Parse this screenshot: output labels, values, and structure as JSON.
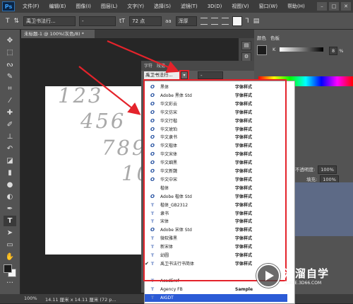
{
  "app": {
    "logo": "Ps"
  },
  "menubar": [
    "文件(F)",
    "编辑(E)",
    "图像(I)",
    "图层(L)",
    "文字(Y)",
    "选择(S)",
    "滤镜(T)",
    "3D(D)",
    "视图(V)",
    "窗口(W)",
    "帮助(H)"
  ],
  "window_controls": [
    "–",
    "□",
    "✕"
  ],
  "options_bar": {
    "tool_icon": "T",
    "font_family": "禹卫书法行...",
    "font_style": "-",
    "font_size": "72 点",
    "antialias": "浑厚"
  },
  "document_tab": "未标题-1 @ 100%(灰色/8) *",
  "canvas_text": [
    "123",
    "456",
    "789",
    "10"
  ],
  "character_panel": {
    "tabs": [
      "字符",
      "段落"
    ],
    "font_field": "禹卫书法行...",
    "dropdown_glyph": "▾",
    "font_style_field": "-"
  },
  "font_list": [
    {
      "icon": "O",
      "name": "黑体",
      "sample": "字体样式"
    },
    {
      "icon": "O",
      "name": "Adobe 黑体 Std",
      "sample": "字体样式"
    },
    {
      "icon": "O",
      "name": "华文彩云",
      "sample": "字体样式"
    },
    {
      "icon": "O",
      "name": "华文仿宋",
      "sample": "字体样式"
    },
    {
      "icon": "O",
      "name": "华文行楷",
      "sample": "字体样式"
    },
    {
      "icon": "O",
      "name": "华文琥珀",
      "sample": "字体样式"
    },
    {
      "icon": "O",
      "name": "华文隶书",
      "sample": "字体样式"
    },
    {
      "icon": "O",
      "name": "华文楷体",
      "sample": "字体样式"
    },
    {
      "icon": "O",
      "name": "华文宋体",
      "sample": "字体样式"
    },
    {
      "icon": "O",
      "name": "华文细黑",
      "sample": "字体样式"
    },
    {
      "icon": "O",
      "name": "华文新魏",
      "sample": "字体样式"
    },
    {
      "icon": "O",
      "name": "华文中宋",
      "sample": "字体样式"
    },
    {
      "icon": "",
      "name": "楷体",
      "sample": "字体样式"
    },
    {
      "icon": "O",
      "name": "Adobe 楷体 Std",
      "sample": "字体样式"
    },
    {
      "icon": "T",
      "name": "楷体_GB2312",
      "sample": "字体样式"
    },
    {
      "icon": "T",
      "name": "隶书",
      "sample": "字体样式"
    },
    {
      "icon": "T",
      "name": "宋体",
      "sample": "字体样式"
    },
    {
      "icon": "O",
      "name": "Adobe 宋体 Std",
      "sample": "字体样式"
    },
    {
      "icon": "T",
      "name": "微软雅黑",
      "sample": "字体样式"
    },
    {
      "icon": "T",
      "name": "新宋体",
      "sample": "字体样式"
    },
    {
      "icon": "T",
      "name": "幼圆",
      "sample": "字体样式"
    },
    {
      "icon": "T",
      "name": "禹卫书法行书简体",
      "sample": "字体样式",
      "checked": true
    },
    {
      "icon": "",
      "name": "",
      "sample": ""
    },
    {
      "icon": "T",
      "name": "AcadEref",
      "sample": ""
    },
    {
      "icon": "T",
      "name": "Agency FB",
      "sample": "Sample"
    },
    {
      "icon": "T",
      "name": "AIGDT",
      "sample": "",
      "selected": true
    }
  ],
  "font_list_check": "✔",
  "scrollbar": {
    "up": "▲",
    "down": "▼"
  },
  "right_panel": {
    "color_tabs": [
      "颜色",
      "色板"
    ],
    "k_label": "K",
    "k_value": "8",
    "k_unit": "%",
    "opacity_label": "不透明度:",
    "opacity_value": "100%",
    "fill_label": "填充:",
    "fill_value": "100%"
  },
  "status_bar": {
    "zoom": "100%",
    "doc_info": "14.11 厘米 x 14.11 厘米 (72 p..."
  },
  "watermark": {
    "title": "溜溜自学",
    "url": "ZIXUE.3D66.COM"
  },
  "colors": {
    "highlight_red": "#e4232b",
    "selection_blue": "#2b5bd6",
    "panel_gray": "#535353"
  }
}
